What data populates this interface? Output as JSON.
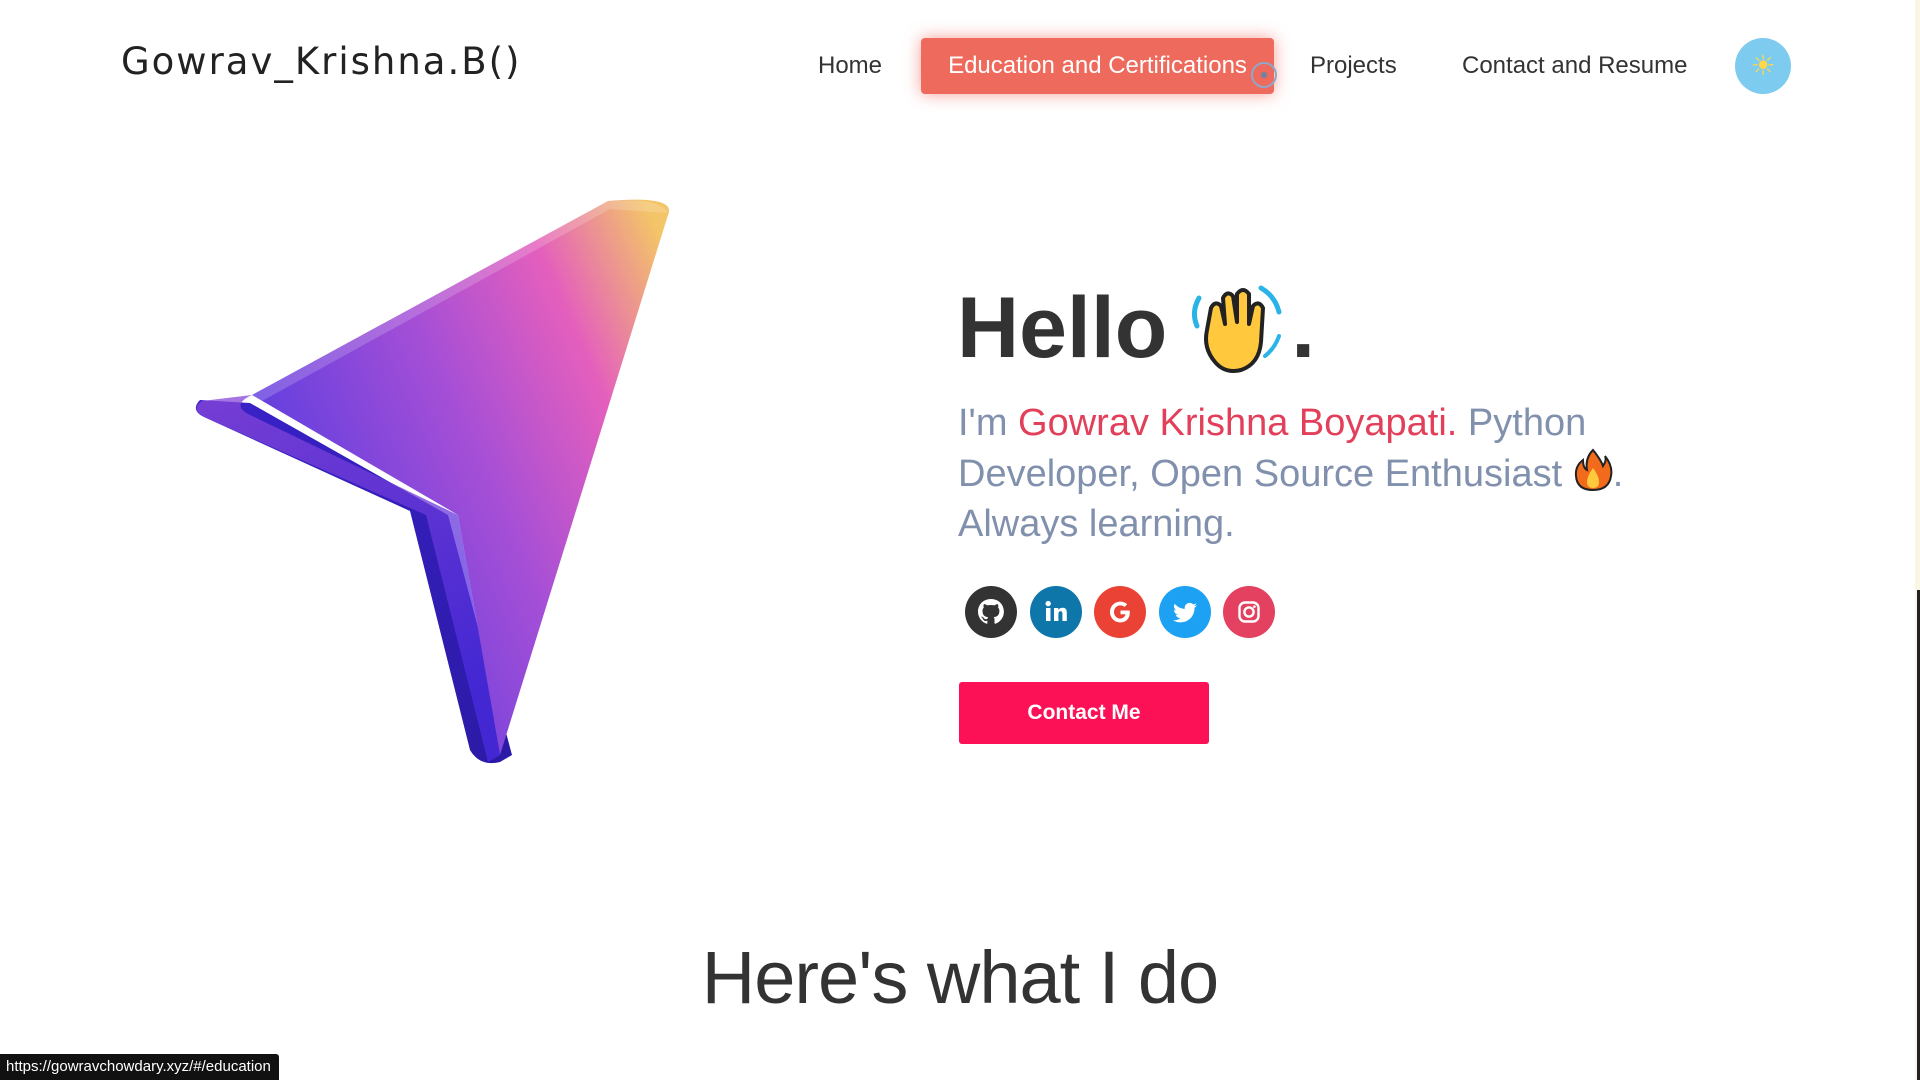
{
  "header": {
    "logo": "Gowrav_Krishna.B()",
    "nav": {
      "home": "Home",
      "education": "Education and Certifications",
      "projects": "Projects",
      "contact": "Contact and Resume"
    },
    "theme_toggle_icon": "sun-icon"
  },
  "hero": {
    "greeting_word": "Hello",
    "greeting_punct": ".",
    "intro_prefix": "I'm ",
    "name": "Gowrav Krishna Boyapati.",
    "intro_rest": " Python Developer, Open Source Enthusiast ",
    "intro_after_fire": ". Always learning.",
    "social_icons": [
      "github-icon",
      "linkedin-icon",
      "google-icon",
      "twitter-icon",
      "instagram-icon"
    ],
    "contact_button": "Contact Me"
  },
  "section": {
    "title": "Here's what I do"
  },
  "status_bar": {
    "url": "https://gowravchowdary.xyz/#/education"
  },
  "colors": {
    "accent_red": "#e2405a",
    "nav_active": "#ee6a5c",
    "button": "#fc1056",
    "toggle": "#7ecbf0",
    "muted_text": "#8190ad"
  }
}
